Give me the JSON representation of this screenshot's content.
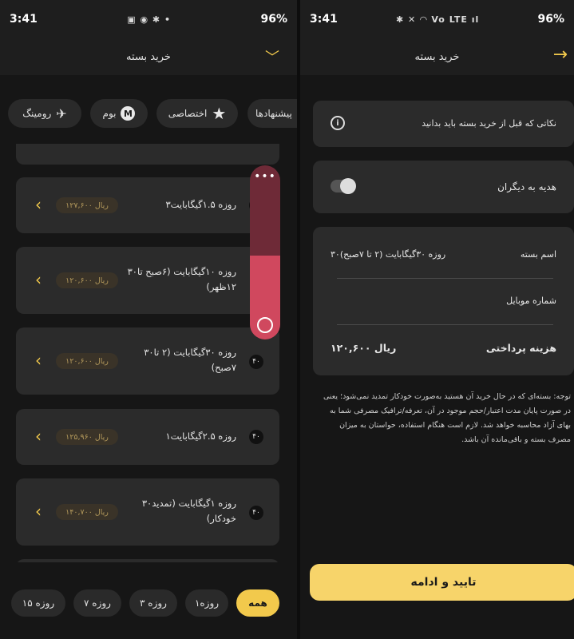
{
  "status": {
    "time": "3:41",
    "battery": "96%",
    "left_icons": "▣ ◉ ✱ •",
    "right_icons": "✱ ✕ ◠ Vo LTE ıl"
  },
  "left": {
    "title": "خرید بسته",
    "tabs": [
      {
        "label": "پیشنهادها"
      },
      {
        "label": "اختصاصی",
        "icon": "star-icon"
      },
      {
        "label": "بوم",
        "icon": "hamrah-icon"
      },
      {
        "label": "رومینگ",
        "icon": "airplane-icon"
      }
    ],
    "packages": [
      {
        "title": "۳روزه ۱.۵گیگابایت",
        "price": "۱۲۷,۶۰۰ ریال"
      },
      {
        "title": "۳۰روزه ۱۰گیگابایت (۶صبح تا ۱۲ظهر)",
        "price": "۱۲۰,۶۰۰ ریال"
      },
      {
        "title": "۳۰روزه ۳۰گیگابایت (۲ تا ۷صبح)",
        "price": "۱۲۰,۶۰۰ ریال"
      },
      {
        "title": "۱روزه ۲.۵گیگابایت",
        "price": "۱۲۵,۹۶۰ ریال"
      },
      {
        "title": "۳۰روزه ۱گیگابایت (تمدید خودکار)",
        "price": "۱۴۰,۷۰۰ ریال"
      }
    ],
    "scroll_progress": 0.48,
    "filters": [
      "همه",
      "۱روزه",
      "۳ روزه",
      "۷ روزه",
      "۱۵ روزه"
    ]
  },
  "right": {
    "title": "خرید بسته",
    "notice": "نکاتی که قبل از خرید بسته باید بدانید",
    "gift_label": "هدیه به دیگران",
    "package_name_label": "اسم بسته",
    "package_name_value": "۳۰روزه ۳۰گیگابایت (۲ تا ۷صبح)",
    "mobile_label": "شماره موبایل",
    "cost_label": "هزینه پرداختی",
    "cost_value": "۱۲۰,۶۰۰ ریال",
    "note_text": "توجه: بسته‌ای که در حال خرید آن هستید به‌صورت خودکار تمدید نمی‌شود؛ یعنی در صورت پایان مدت اعتبار/حجم موجود در آن، تعرفه/ترافیک مصرفی شما به بهای آزاد محاسبه خواهد شد. لازم است هنگام استفاده، حواستان به میزان مصرف بسته و باقی‌مانده آن باشد.",
    "confirm_label": "تایید و ادامه"
  },
  "colors": {
    "accent": "#f2c94c",
    "scroll": "#d0485e"
  }
}
